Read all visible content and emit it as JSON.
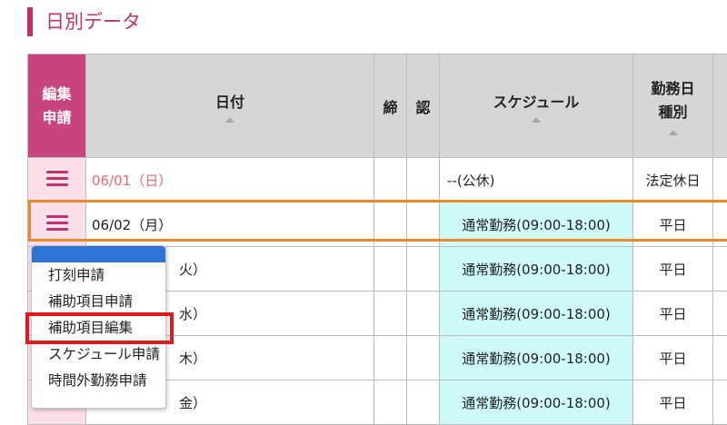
{
  "section": {
    "title": "日別データ"
  },
  "table": {
    "headers": {
      "edit_line1": "編集",
      "edit_line2": "申請",
      "date": "日付",
      "close": "締",
      "approve": "認",
      "schedule": "スケジュール",
      "daytype_line1": "勤務日",
      "daytype_line2": "種別"
    },
    "rows": [
      {
        "date": "06/01（日）",
        "schedule": "--(公休)",
        "daytype": "法定休日"
      },
      {
        "date": "06/02（月）",
        "schedule": "通常勤務(09:00-18:00)",
        "daytype": "平日"
      },
      {
        "date": "火）",
        "schedule": "通常勤務(09:00-18:00)",
        "daytype": "平日"
      },
      {
        "date": "水）",
        "schedule": "通常勤務(09:00-18:00)",
        "daytype": "平日"
      },
      {
        "date": "木）",
        "schedule": "通常勤務(09:00-18:00)",
        "daytype": "平日"
      },
      {
        "date": "金）",
        "schedule": "通常勤務(09:00-18:00)",
        "daytype": "平日"
      }
    ]
  },
  "menu": {
    "items": [
      "打刻申請",
      "補助項目申請",
      "補助項目編集",
      "スケジュール申請",
      "時間外勤務申請"
    ]
  },
  "colors": {
    "accent": "#c0306e",
    "header_edit": "#c8447d",
    "schedule_bg": "#cffafa",
    "highlight_row": "#e8892f",
    "selected_box": "#e0191b",
    "menu_bar": "#2f73d6"
  }
}
